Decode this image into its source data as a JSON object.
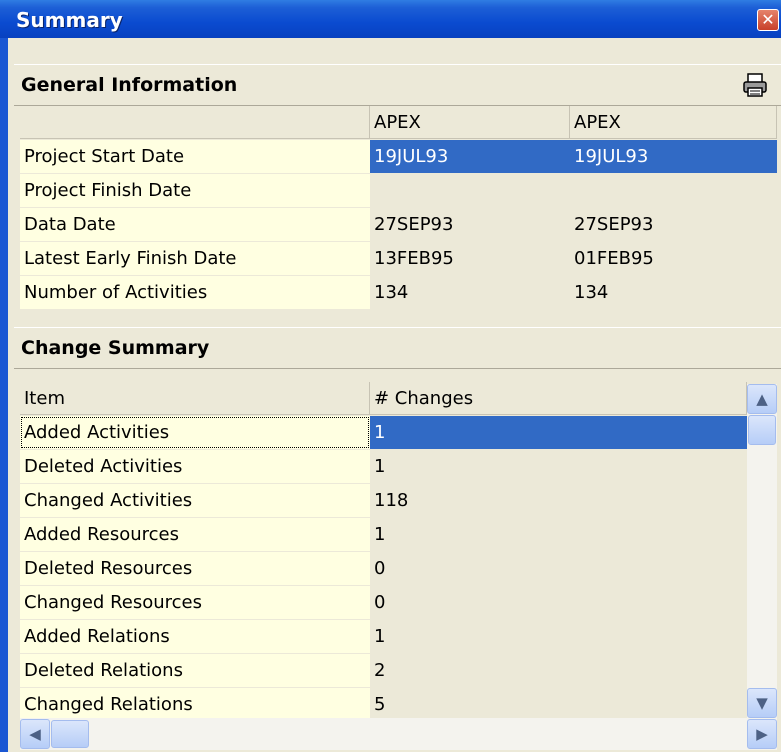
{
  "window": {
    "title": "Summary"
  },
  "general": {
    "heading": "General Information",
    "columns": [
      "",
      "APEX",
      "APEX"
    ],
    "rows": [
      {
        "label": "Project Start Date",
        "v1": "19JUL93",
        "v2": "19JUL93"
      },
      {
        "label": "Project Finish Date",
        "v1": "",
        "v2": ""
      },
      {
        "label": "Data Date",
        "v1": "27SEP93",
        "v2": "27SEP93"
      },
      {
        "label": "Latest Early Finish Date",
        "v1": "13FEB95",
        "v2": "01FEB95"
      },
      {
        "label": "Number of Activities",
        "v1": "134",
        "v2": "134"
      }
    ]
  },
  "changes": {
    "heading": "Change Summary",
    "columns": [
      "Item",
      "# Changes"
    ],
    "rows": [
      {
        "item": "Added Activities",
        "count": "1"
      },
      {
        "item": "Deleted Activities",
        "count": "1"
      },
      {
        "item": "Changed Activities",
        "count": "118"
      },
      {
        "item": "Added Resources",
        "count": "1"
      },
      {
        "item": "Deleted Resources",
        "count": "0"
      },
      {
        "item": "Changed Resources",
        "count": "0"
      },
      {
        "item": "Added Relations",
        "count": "1"
      },
      {
        "item": "Deleted Relations",
        "count": "2"
      },
      {
        "item": "Changed Relations",
        "count": "5"
      }
    ]
  },
  "icons": {
    "close": "close-icon",
    "print": "printer-icon",
    "scroll_up": "arrow-up-icon",
    "scroll_down": "arrow-down-icon",
    "scroll_left": "arrow-left-icon",
    "scroll_right": "arrow-right-icon"
  },
  "colors": {
    "selection": "#316ac5",
    "label_background": "#ffffe1",
    "titlebar": "#0a4bd0"
  }
}
